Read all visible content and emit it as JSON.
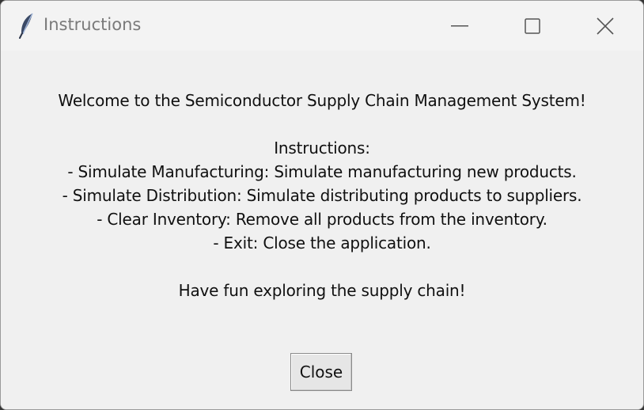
{
  "window": {
    "title": "Instructions",
    "icons": {
      "app": "feather-icon",
      "minimize": "minimize-icon",
      "maximize": "maximize-icon",
      "close": "close-icon"
    }
  },
  "message": {
    "lines": [
      "Welcome to the Semiconductor Supply Chain Management System!",
      "",
      "Instructions:",
      "- Simulate Manufacturing: Simulate manufacturing new products.",
      "- Simulate Distribution: Simulate distributing products to suppliers.",
      "- Clear Inventory: Remove all products from the inventory.",
      "- Exit: Close the application.",
      "",
      "Have fun exploring the supply chain!"
    ]
  },
  "actions": {
    "close_label": "Close"
  }
}
